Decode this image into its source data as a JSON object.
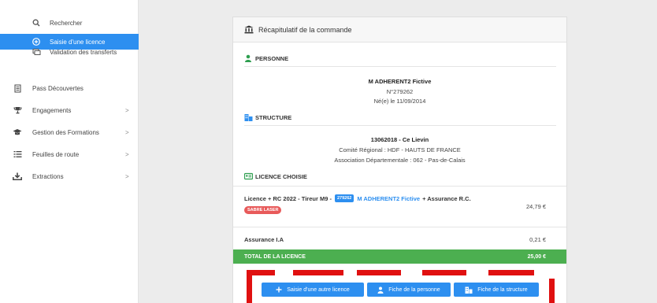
{
  "sidebar": {
    "items": [
      {
        "label": "Rechercher",
        "icon": "search-icon"
      },
      {
        "label": "Saisie d'une licence",
        "icon": "plus-circle-icon"
      },
      {
        "label": "Validation des transferts",
        "icon": "transfer-icon"
      },
      {
        "label": "Pass Découvertes",
        "icon": "document-icon"
      },
      {
        "label": "Engagements",
        "icon": "trophy-icon"
      },
      {
        "label": "Gestion des Formations",
        "icon": "graduation-cap-icon"
      },
      {
        "label": "Feuilles de route",
        "icon": "list-icon"
      },
      {
        "label": "Extractions",
        "icon": "download-icon"
      }
    ],
    "chevron": ">"
  },
  "card": {
    "title": "Récapitulatif de la commande",
    "personne": {
      "section_title": "PERSONNE",
      "name": "M ADHERENT2 Fictive",
      "number": "N°279262",
      "birth": "Né(e) le 11/09/2014"
    },
    "structure": {
      "section_title": "STRUCTURE",
      "name": "13062018 - Ce Lievin",
      "regional": "Comité Régional : HDF - HAUTS DE FRANCE",
      "departemental": "Association Départementale : 062 - Pas-de-Calais"
    },
    "licence": {
      "section_title": "LICENCE CHOISIE",
      "prefix": "Licence + RC 2022 - Tireur M9 -",
      "badge_number": "279262",
      "person_link": "M ADHERENT2 Fictive",
      "suffix": "+ Assurance R.C.",
      "tag": "SABRE LASER",
      "price": "24,79 €"
    },
    "assurance": {
      "label": "Assurance I.A",
      "price": "0,21 €"
    },
    "total": {
      "label": "TOTAL DE LA LICENCE",
      "value": "25,00 €"
    },
    "buttons": {
      "another_licence": "Saisie d'une autre licence",
      "person_sheet": "Fiche de la personne",
      "structure_sheet": "Fiche de la structure"
    }
  },
  "colors": {
    "accent": "#2d8ff0",
    "total_bar": "#4caf50",
    "tag": "#e85a5a",
    "person_icon": "#2e9e4f",
    "highlight": "#e01010"
  }
}
